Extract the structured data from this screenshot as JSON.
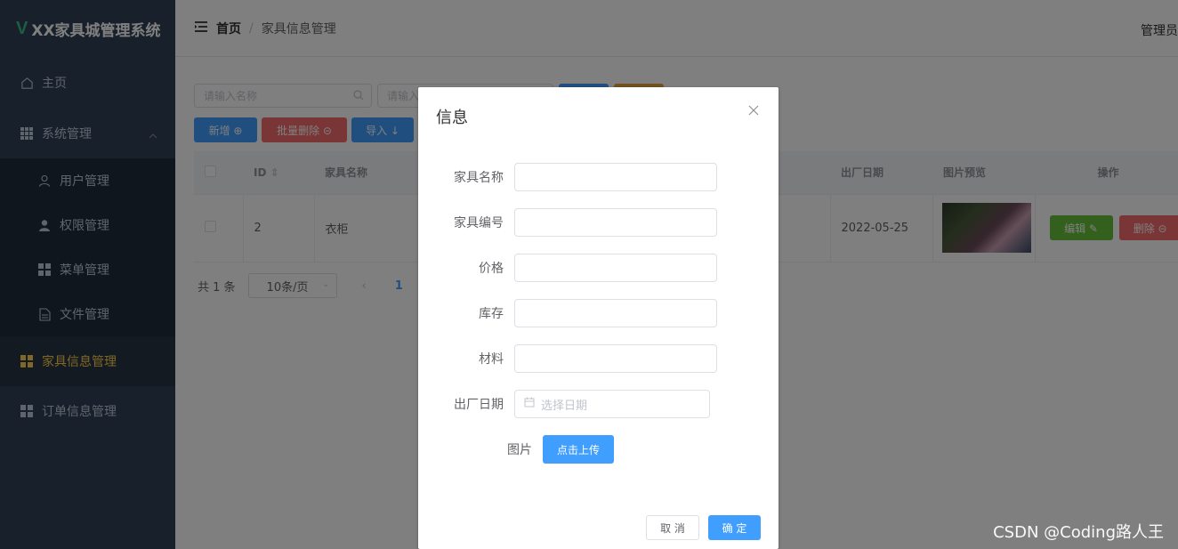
{
  "app": {
    "logo_mark": "V",
    "title": "XX家具城管理系统"
  },
  "sidebar": {
    "home": "主页",
    "system": "系统管理",
    "sub_items": [
      "用户管理",
      "权限管理",
      "菜单管理",
      "文件管理"
    ],
    "furniture": "家具信息管理",
    "orders": "订单信息管理"
  },
  "header": {
    "home": "首页",
    "separator": "/",
    "current": "家具信息管理",
    "user": "管理员"
  },
  "search": {
    "name_placeholder": "请输入名称",
    "second_placeholder": "请输入"
  },
  "toolbar": {
    "add": "新增 ⊕",
    "batch_delete": "批量删除 ⊝",
    "import": "导入 ↓"
  },
  "table": {
    "headers": {
      "id": "ID",
      "name": "家具名称",
      "date": "出厂日期",
      "preview": "图片预览",
      "ops": "操作"
    },
    "rows": [
      {
        "id": "2",
        "name": "衣柜",
        "date": "2022-05-25",
        "edit": "编辑 ✎",
        "delete": "删除 ⊝"
      }
    ]
  },
  "pager": {
    "total": "共 1 条",
    "size": "10条/页",
    "prev": "‹",
    "page": "1"
  },
  "dialog": {
    "title": "信息",
    "labels": {
      "name": "家具名称",
      "code": "家具编号",
      "price": "价格",
      "stock": "库存",
      "material": "材料",
      "date": "出厂日期",
      "image": "图片"
    },
    "date_placeholder": "选择日期",
    "upload": "点击上传",
    "cancel": "取 消",
    "confirm": "确 定"
  },
  "watermark": "CSDN @Coding路人王",
  "colors": {
    "sidebar_bg": "#304156",
    "active_text": "#ffd04b",
    "primary": "#409eff",
    "danger": "#f56c6c",
    "success": "#67c23a",
    "warning": "#e6a23c"
  }
}
